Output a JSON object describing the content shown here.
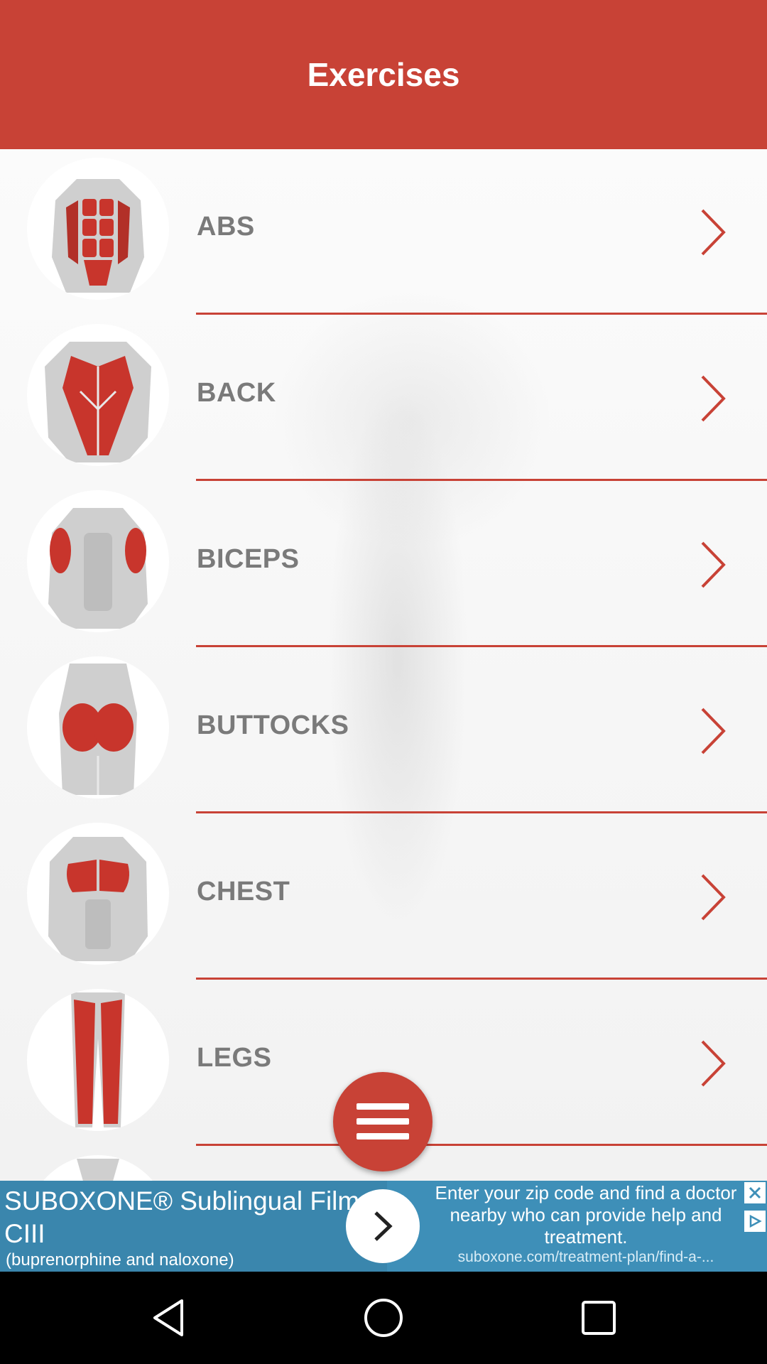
{
  "header": {
    "title": "Exercises"
  },
  "exercises": [
    {
      "label": "ABS",
      "icon": "abs-muscle-icon"
    },
    {
      "label": "BACK",
      "icon": "back-muscle-icon"
    },
    {
      "label": "BICEPS",
      "icon": "biceps-muscle-icon"
    },
    {
      "label": "BUTTOCKS",
      "icon": "buttocks-muscle-icon"
    },
    {
      "label": "CHEST",
      "icon": "chest-muscle-icon"
    },
    {
      "label": "LEGS",
      "icon": "legs-muscle-icon"
    }
  ],
  "ad": {
    "title": "SUBOXONE® Sublingual Film CIII",
    "subtitle": "(buprenorphine and naloxone)",
    "description": "Enter your zip code and find a doctor nearby who can provide help and treatment.",
    "url": "suboxone.com/treatment-plan/find-a-..."
  },
  "colors": {
    "accent": "#c84236",
    "label": "#7a7a7a",
    "ad_background": "#3e8fb8"
  },
  "icons": {
    "menu": "hamburger-menu-icon",
    "chevron": "chevron-right-icon",
    "nav_back": "back-triangle-icon",
    "nav_home": "home-circle-icon",
    "nav_recents": "recents-square-icon"
  }
}
